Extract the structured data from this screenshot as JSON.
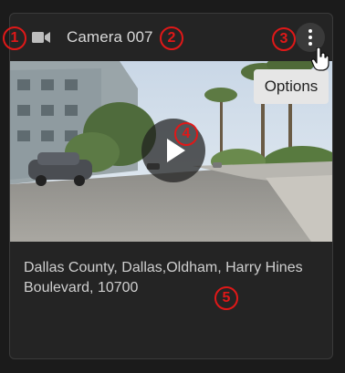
{
  "card": {
    "title": "Camera 007",
    "address": "Dallas County,  Dallas,Oldham, Harry Hines Boulevard, 10700",
    "camera_icon": "video-camera-icon",
    "options_icon": "vertical-ellipsis-icon",
    "play_icon": "play-icon",
    "thumbnail": "street-scene-thumbnail"
  },
  "tooltip": {
    "text": "Options"
  },
  "annotations": {
    "badge_1": "1",
    "badge_2": "2",
    "badge_3": "3",
    "badge_4": "4",
    "badge_5": "5"
  },
  "colors": {
    "background": "#1b1b1b",
    "card": "#242424",
    "annotation_red": "#e01818",
    "tooltip_bg": "#e6e6e6"
  }
}
